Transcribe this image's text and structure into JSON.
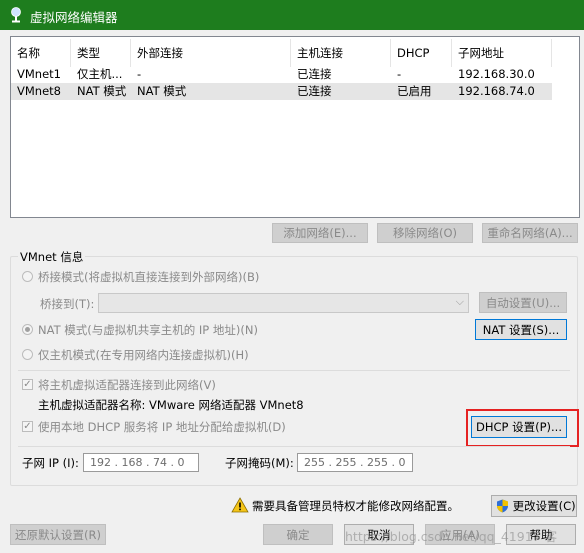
{
  "window": {
    "title": "虚拟网络编辑器",
    "title_bar_color": "#1e7d1e"
  },
  "network_list": {
    "columns": [
      "名称",
      "类型",
      "外部连接",
      "主机连接",
      "DHCP",
      "子网地址"
    ],
    "rows": [
      [
        "VMnet1",
        "仅主机...",
        "-",
        "已连接",
        "-",
        "192.168.30.0"
      ],
      [
        "VMnet8",
        "NAT 模式",
        "NAT 模式",
        "已连接",
        "已启用",
        "192.168.74.0"
      ]
    ],
    "selected_row": 1
  },
  "list_buttons": {
    "add": "添加网络(E)...",
    "remove": "移除网络(O)",
    "rename": "重命名网络(A)..."
  },
  "vmnet_info": {
    "group_title": "VMnet 信息",
    "bridged_label": "桥接模式(将虚拟机直接连接到外部网络)(B)",
    "bridged_to_label": "桥接到(T):",
    "bridged_to_value": "",
    "auto_settings": "自动设置(U)...",
    "nat_label": "NAT 模式(与虚拟机共享主机的 IP 地址)(N)",
    "nat_settings": "NAT 设置(S)...",
    "hostonly_label": "仅主机模式(在专用网络内连接虚拟机)(H)",
    "connect_adapter_label": "将主机虚拟适配器连接到此网络(V)",
    "adapter_name_label": "主机虚拟适配器名称: VMware 网络适配器 VMnet8",
    "dhcp_label": "使用本地 DHCP 服务将 IP 地址分配给虚拟机(D)",
    "dhcp_settings": "DHCP 设置(P)...",
    "subnet_ip_label": "子网 IP (I):",
    "subnet_ip": "192 . 168 . 74 . 0",
    "subnet_mask_label": "子网掩码(M):",
    "subnet_mask": "255 . 255 . 255 . 0"
  },
  "admin_notice": "需要具备管理员特权才能修改网络配置。",
  "footer": {
    "change_settings": "更改设置(C)",
    "restore_defaults": "还原默认设置(R)",
    "ok": "确定",
    "cancel": "取消",
    "apply": "应用(A)",
    "help": "帮助"
  },
  "watermark": "https://blog.csdn.net/qq_41917 客"
}
